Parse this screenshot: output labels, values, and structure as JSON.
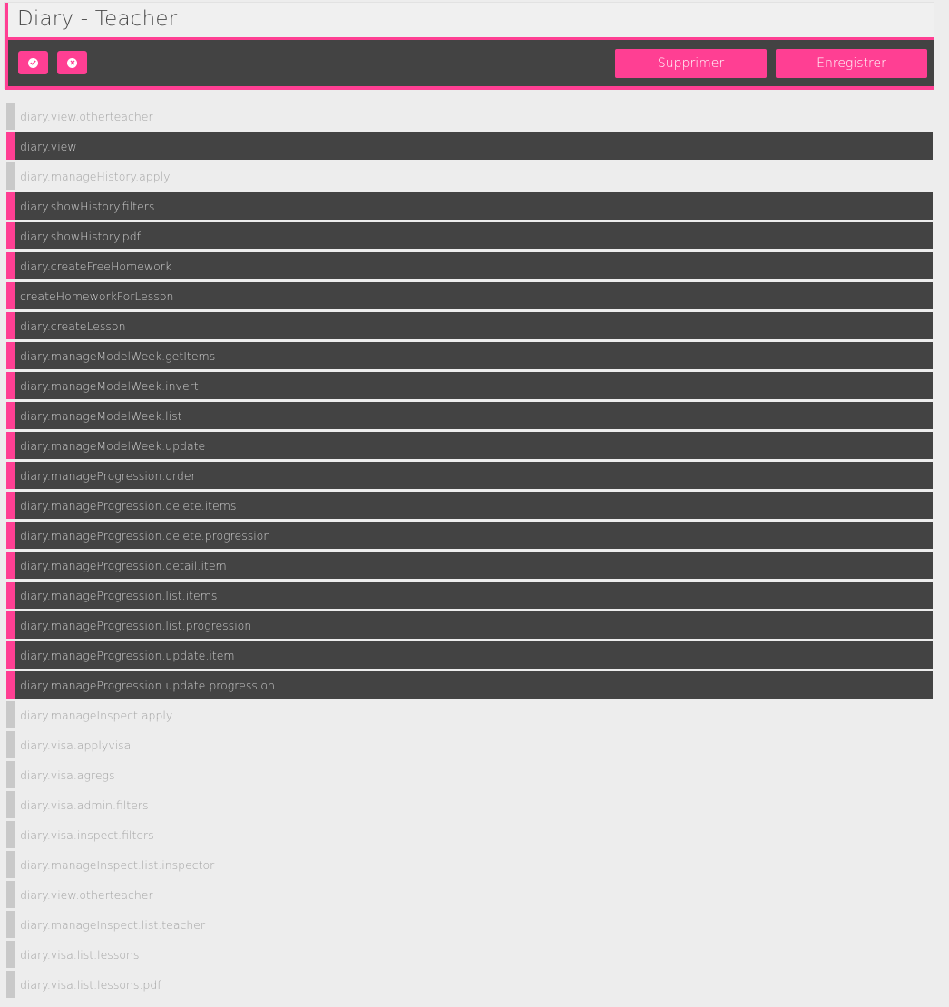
{
  "header": {
    "title": "Diary - Teacher"
  },
  "toolbar": {
    "select_all_icon": "check-circle-icon",
    "deselect_all_icon": "x-circle-icon",
    "delete_label": "Supprimer",
    "save_label": "Enregistrer"
  },
  "colors": {
    "accent": "#ff3f93",
    "dark": "#434343",
    "page_bg": "#ededed",
    "inactive_marker": "#c9c9c9"
  },
  "rights": [
    {
      "label": "diary.view.otherteacher",
      "enabled": false
    },
    {
      "label": "diary.view",
      "enabled": true
    },
    {
      "label": "diary.manageHistory.apply",
      "enabled": false
    },
    {
      "label": "diary.showHistory.filters",
      "enabled": true
    },
    {
      "label": "diary.showHistory.pdf",
      "enabled": true
    },
    {
      "label": "diary.createFreeHomework",
      "enabled": true
    },
    {
      "label": "createHomeworkForLesson",
      "enabled": true
    },
    {
      "label": "diary.createLesson",
      "enabled": true
    },
    {
      "label": "diary.manageModelWeek.getItems",
      "enabled": true
    },
    {
      "label": "diary.manageModelWeek.invert",
      "enabled": true
    },
    {
      "label": "diary.manageModelWeek.list",
      "enabled": true
    },
    {
      "label": "diary.manageModelWeek.update",
      "enabled": true
    },
    {
      "label": "diary.manageProgression.order",
      "enabled": true
    },
    {
      "label": "diary.manageProgression.delete.items",
      "enabled": true
    },
    {
      "label": "diary.manageProgression.delete.progression",
      "enabled": true
    },
    {
      "label": "diary.manageProgression.detail.item",
      "enabled": true
    },
    {
      "label": "diary.manageProgression.list.items",
      "enabled": true
    },
    {
      "label": "diary.manageProgression.list.progression",
      "enabled": true
    },
    {
      "label": "diary.manageProgression.update.item",
      "enabled": true
    },
    {
      "label": "diary.manageProgression.update.progression",
      "enabled": true
    },
    {
      "label": "diary.manageInspect.apply",
      "enabled": false
    },
    {
      "label": "diary.visa.applyvisa",
      "enabled": false
    },
    {
      "label": "diary.visa.agregs",
      "enabled": false
    },
    {
      "label": "diary.visa.admin.filters",
      "enabled": false
    },
    {
      "label": "diary.visa.inspect.filters",
      "enabled": false
    },
    {
      "label": "diary.manageInspect.list.inspector",
      "enabled": false
    },
    {
      "label": "diary.view.otherteacher",
      "enabled": false
    },
    {
      "label": "diary.manageInspect.list.teacher",
      "enabled": false
    },
    {
      "label": "diary.visa.list.lessons",
      "enabled": false
    },
    {
      "label": "diary.visa.list.lessons.pdf",
      "enabled": false
    }
  ]
}
